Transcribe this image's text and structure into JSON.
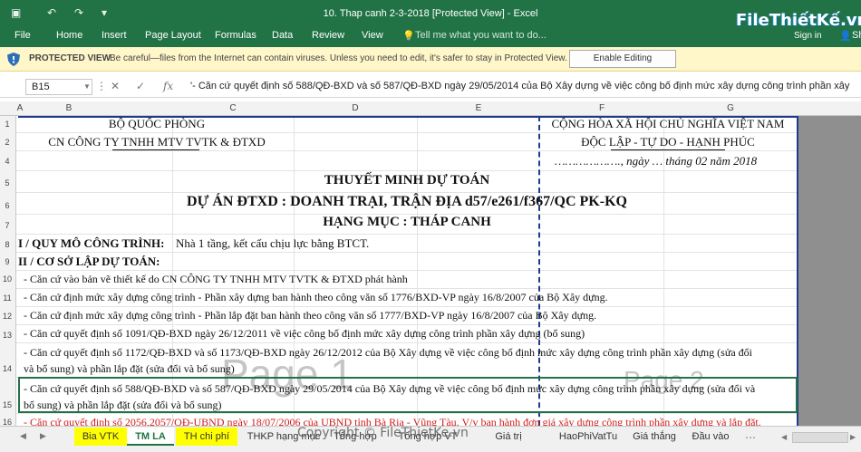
{
  "titlebar": {
    "title": "10. Thap canh 2-3-2018  [Protected View] - Excel",
    "save_icon": "save-icon",
    "sign_in": "Sign in",
    "logo_text": "FileThiếtKế.vn"
  },
  "ribbon": {
    "tabs": [
      "File",
      "Home",
      "Insert",
      "Page Layout",
      "Formulas",
      "Data",
      "Review",
      "View"
    ],
    "tell_me": "Tell me what you want to do...",
    "share": "Sh"
  },
  "protected": {
    "label": "PROTECTED VIEW",
    "message": "Be careful—files from the Internet can contain viruses. Unless you need to edit, it's safer to stay in Protected View.",
    "button": "Enable Editing"
  },
  "formula_bar": {
    "name_box": "B15",
    "fx": "fx",
    "content": "'- Căn cứ quyết định số 588/QĐ-BXD và số 587/QĐ-BXD ngày 29/05/2014 của Bộ Xây dựng về việc công bố định mức xây dựng công trình phần xây"
  },
  "columns": [
    "A",
    "B",
    "C",
    "D",
    "E",
    "F",
    "G"
  ],
  "rows": [
    "1",
    "2",
    "4",
    "5",
    "6",
    "7",
    "8",
    "9",
    "10",
    "11",
    "12",
    "13",
    "14",
    "15",
    "16"
  ],
  "sheet": {
    "org1": "BỘ QUỐC PHÒNG",
    "org2": "CN CÔNG TY TNHH MTV TVTK & ĐTXD",
    "nation": "CỘNG HÒA XÃ HỘI CHỦ NGHĨA VIỆT NAM",
    "motto": "ĐỘC LẬP - TỰ DO - HẠNH PHÚC",
    "date": "………………., ngày … tháng 02 năm 2018",
    "title1": "THUYẾT MINH DỰ TOÁN",
    "title2": "DỰ ÁN ĐTXD : DOANH TRẠI, TRẬN ĐỊA d57/e261/f367/QC PK-KQ",
    "title3": "HẠNG MỤC : THÁP CANH",
    "sec1_label": "I / QUY MÔ CÔNG TRÌNH:",
    "sec1_text": "Nhà 1 tầng, kết cấu chịu lực bằng BTCT.",
    "sec2_label": "II / CƠ SỞ LẬP DỰ TOÁN:",
    "r10": "- Căn cứ vào bản vẽ thiết kế do CN CÔNG TY TNHH MTV TVTK & ĐTXD phát hành",
    "r11": "- Căn cứ định mức xây dựng công trình - Phần xây dựng ban hành theo công văn số 1776/BXD-VP ngày 16/8/2007 của Bộ Xây dựng.",
    "r12": "- Căn cứ định mức xây dựng công trình - Phần lắp đặt ban hành theo công văn số 1777/BXD-VP ngày 16/8/2007 của Bộ Xây dựng.",
    "r13": "- Căn cứ quyết định số 1091/QĐ-BXD ngày 26/12/2011 về việc công bố định mức xây dựng công trình phần xây dựng (bổ sung)",
    "r14a": "- Căn cứ quyết định số 1172/QĐ-BXD và số 1173/QĐ-BXD ngày 26/12/2012 của Bộ Xây dựng về việc công bố định mức xây dựng công trình phần xây dựng (sửa đổi",
    "r14b": "và bổ sung) và phần lắp đặt (sửa đổi và bổ sung)",
    "r15a": "- Căn cứ quyết định số 588/QĐ-BXD và số 587/QĐ-BXD ngày 29/05/2014 của Bộ Xây dựng về việc công bố định mức xây dựng công trình phần xây dựng (sửa đổi và",
    "r15b": "bổ sung) và phần lắp đặt (sửa đổi và bổ sung)",
    "r16": "- Căn cứ quyết định số 2056,2057/QĐ-UBND ngày 18/07/2006 của UBND tỉnh Bà Rịa - Vũng Tàu. V/v ban hành đơn giá xây dựng công trình phần xây dựng và lắp đặt.",
    "page1": "Page 1",
    "page2": "Page 2"
  },
  "tabs": [
    "Bia VTK",
    "TM LA",
    "TH chi phí",
    "THKP hạng mục",
    "Tổng hợp",
    "Tổng hợp VT",
    "Giá trị",
    "HaoPhiVatTu",
    "Giá thắng",
    "Đầu vào"
  ],
  "copyright": "Copyright © FileThietKe.vn"
}
